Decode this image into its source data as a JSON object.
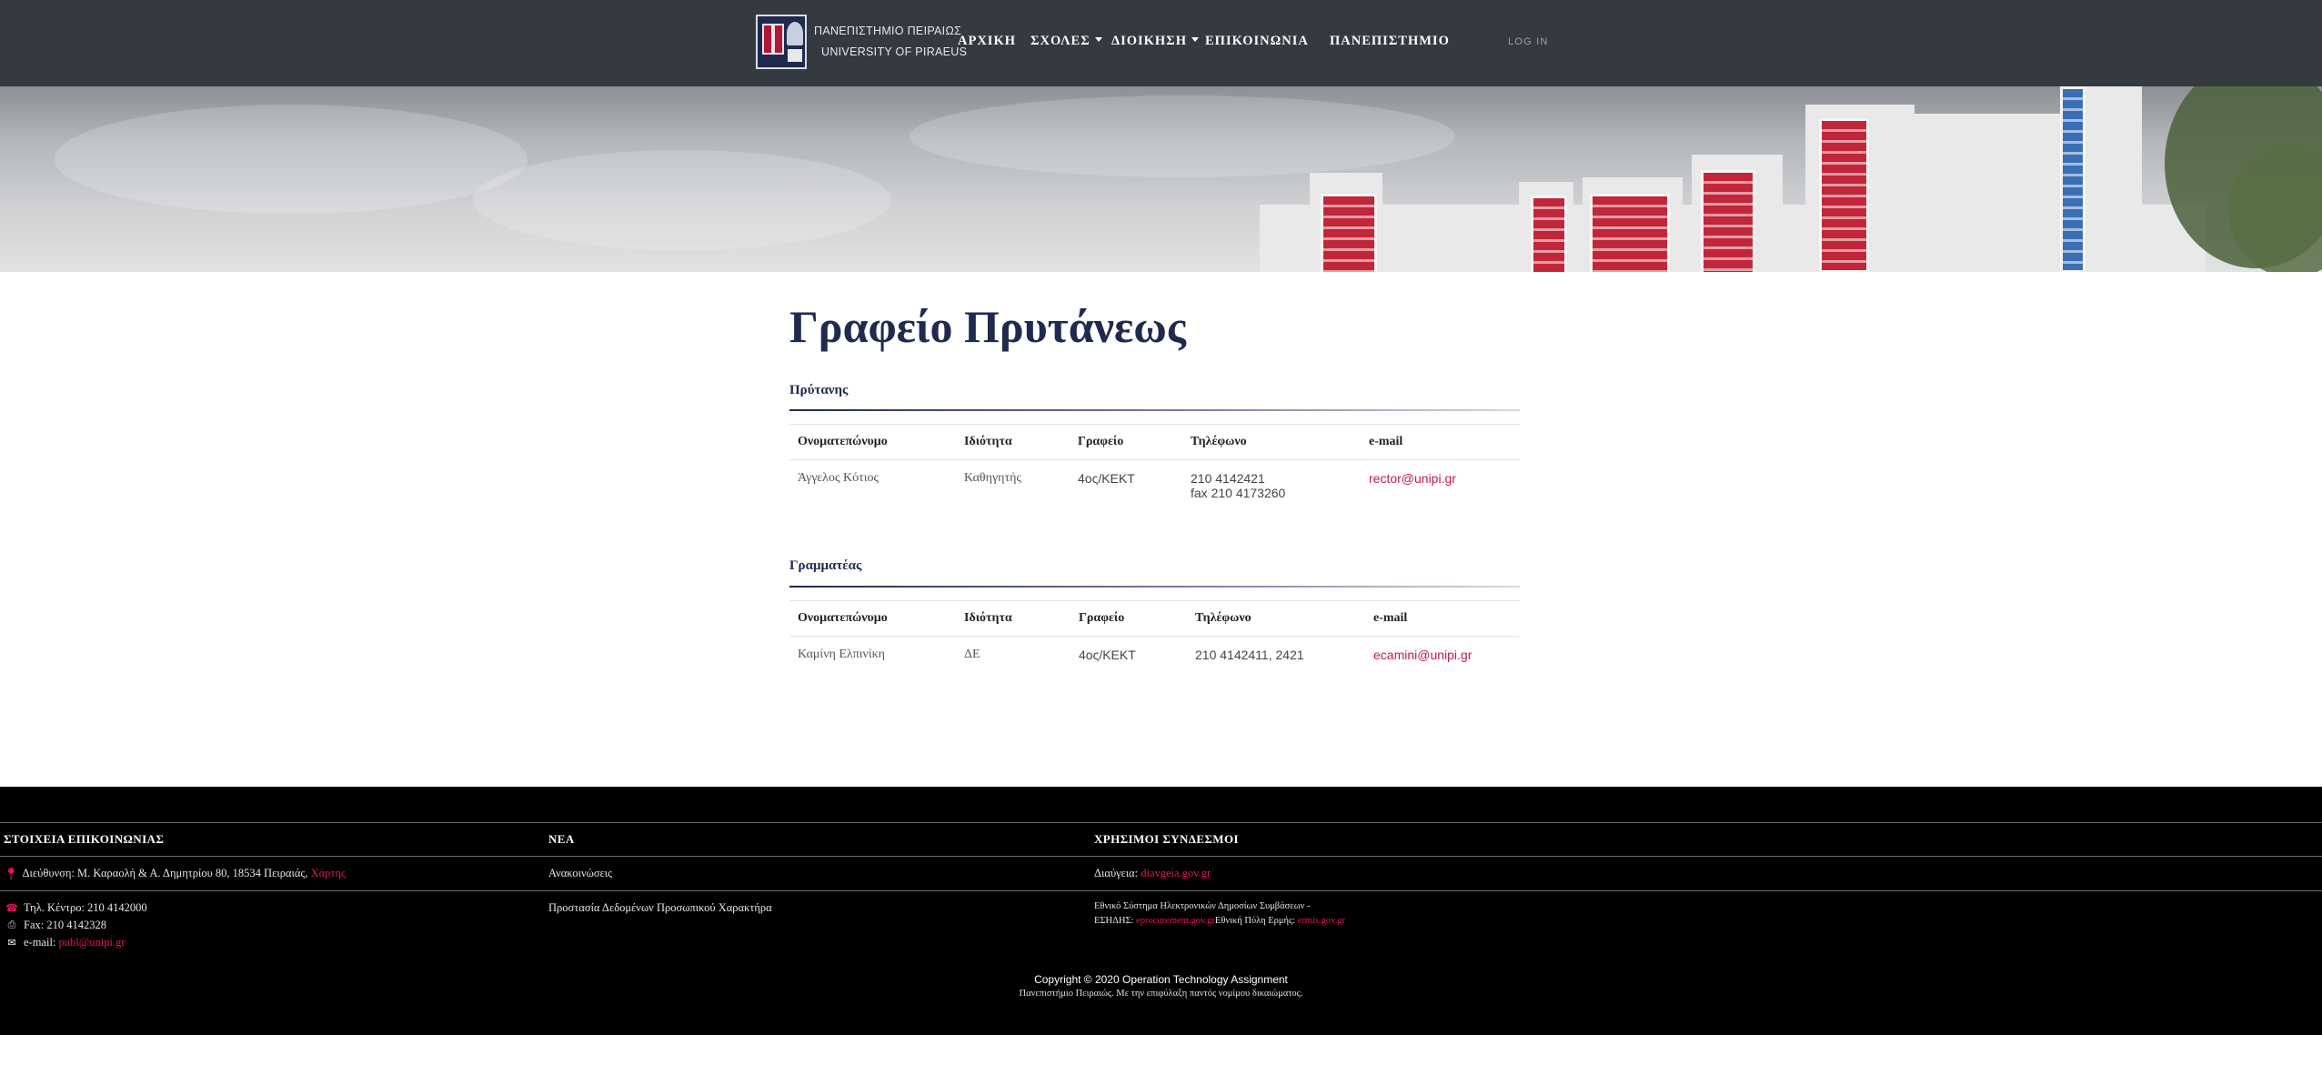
{
  "brand": {
    "line1": "ΠΑΝΕΠΙΣΤΗΜΙΟ ΠΕΙΡΑΙΩΣ",
    "line2": "UNIVERSITY OF PIRAEUS"
  },
  "nav": {
    "home": "ΑΡΧΙΚΗ",
    "schools": "ΣΧΟΛΕΣ",
    "administration": "ΔΙΟΙΚΗΣΗ",
    "contact": "ΕΠΙΚΟΙΝΩΝΙΑ",
    "university": "ΠΑΝΕΠΙΣΤΗΜΙΟ",
    "login": "LOG IN"
  },
  "page": {
    "title": "Γραφείο Πρυτάνεως"
  },
  "columns": {
    "name": "Ονοματεπώνυμο",
    "role": "Ιδιότητα",
    "office": "Γραφείο",
    "phone": "Τηλέφωνο",
    "email": "e-mail"
  },
  "rector": {
    "heading": "Πρύτανης",
    "name": "Άγγελος Κότιος",
    "role": "Καθηγητής",
    "office": "4ος/ΚΕΚΤ",
    "phone": "210 4142421",
    "fax": "fax 210 4173260",
    "email": "rector@unipi.gr"
  },
  "secretary": {
    "heading": "Γραμματέας",
    "name": "Καμίνη Ελπινίκη",
    "role": "ΔΕ",
    "office": "4ος/ΚΕΚΤ",
    "phone": "210 4142411, 2421",
    "email": "ecamini@unipi.gr"
  },
  "footer": {
    "contact_heading": "ΣΤΟΙΧΕΙΑ ΕΠΙΚΟΙΝΩΝΙΑΣ",
    "address": "Διεύθυνση: Μ. Καραολή & Α. Δημητρίου 80, 18534 Πειραιάς,",
    "map_link": "Χάρτης",
    "phone": "Τηλ. Κέντρο: 210 4142000",
    "fax": "Fax: 210 4142328",
    "email_label": "e-mail:",
    "email": "publ@unipi.gr",
    "news_heading": "ΝΕΑ",
    "news_item1": "Ανακοινώσεις",
    "news_item2": "Προστασία Δεδομένων Προσωπικού Χαρακτήρα",
    "links_heading": "ΧΡΗΣΙΜΟΙ ΣΥΝΔΕΣΜΟΙ",
    "diavgeia_label": "Διαύγεια:",
    "diavgeia_link": "diavgeia.gov.gr",
    "esidis_line1": "Εθνικό Σύστημα Ηλεκτρονικών Δημοσίων Συμβάσεων -",
    "esidis_label": "ΕΣΗΔΗΣ:",
    "esidis_link": "eprocurement.gov.gr",
    "ermis_label": "Εθνική Πύλη Ερμής:",
    "ermis_link": "ermis.gov.gr",
    "copyright": "Copyright © 2020 Operation Technology Assignment",
    "rights": "Πανεπιστήμιο Πειραιώς. Με την επιφύλαξη παντός νομίμου δικαιώματος."
  },
  "colors": {
    "navbar": "#343a40",
    "title_navy": "#1f2a4e",
    "link": "#c2185b",
    "footer_bg": "#000000",
    "footer_link": "#e2185f"
  },
  "icons": [
    "map-marker-icon",
    "phone-icon",
    "fax-icon",
    "envelope-icon"
  ]
}
